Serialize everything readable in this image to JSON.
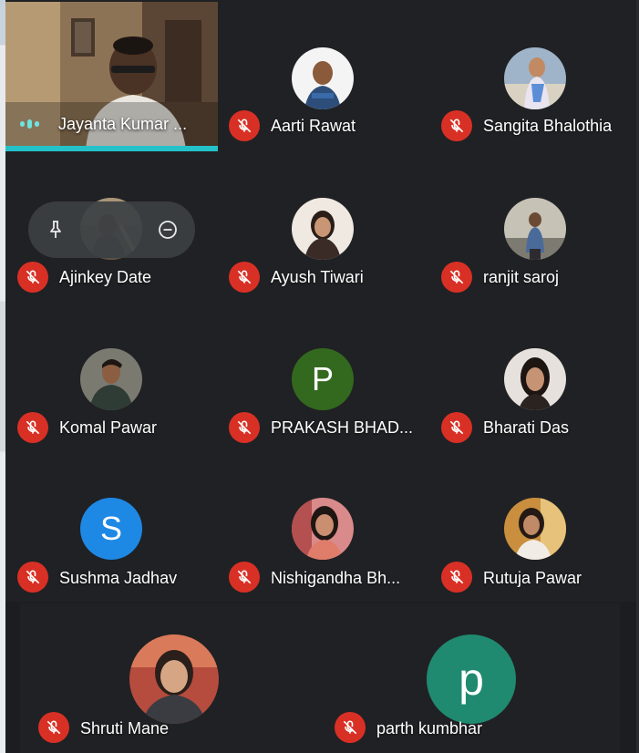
{
  "meeting": {
    "active_speaker": {
      "name": "Jayanta Kumar ..."
    },
    "hover_controls": {
      "pin_icon": "pin-icon",
      "remove_icon": "minus-circle-icon"
    },
    "participants": [
      {
        "name": "Aarti Rawat",
        "mic": "off",
        "avatar": "photo"
      },
      {
        "name": "Sangita Bhalothia",
        "mic": "off",
        "avatar": "photo"
      },
      {
        "name": "Ajinkey Date",
        "mic": "off",
        "avatar": "photo"
      },
      {
        "name": "Ayush Tiwari",
        "mic": "off",
        "avatar": "photo"
      },
      {
        "name": "ranjit saroj",
        "mic": "off",
        "avatar": "photo"
      },
      {
        "name": "Komal Pawar",
        "mic": "off",
        "avatar": "photo"
      },
      {
        "name": "PRAKASH BHAD...",
        "mic": "off",
        "avatar_letter": "P",
        "avatar_color": "#33691e"
      },
      {
        "name": "Bharati Das",
        "mic": "off",
        "avatar": "photo"
      },
      {
        "name": "Sushma Jadhav",
        "mic": "off",
        "avatar_letter": "S",
        "avatar_color": "#1e88e5"
      },
      {
        "name": "Nishigandha Bh...",
        "mic": "off",
        "avatar": "photo"
      },
      {
        "name": "Rutuja Pawar",
        "mic": "off",
        "avatar": "photo"
      },
      {
        "name": "Shruti Mane",
        "mic": "off",
        "avatar": "photo"
      },
      {
        "name": "parth kumbhar",
        "mic": "off",
        "avatar_letter": "p",
        "avatar_color": "#1f8a70"
      }
    ],
    "colors": {
      "background": "#202124",
      "mic_off": "#d93025",
      "speaking_accent": "#24c1c9"
    }
  }
}
